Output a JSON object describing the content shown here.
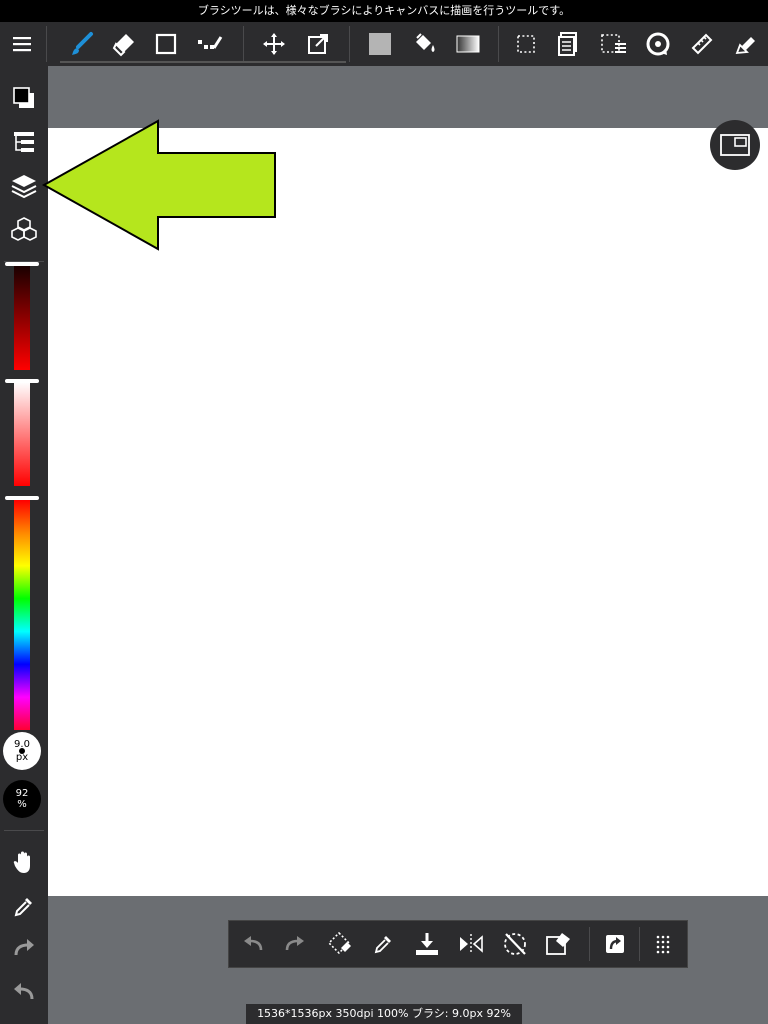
{
  "status_bar": {
    "message": "ブラシツールは、様々なブラシによりキャンバスに描画を行うツールです。"
  },
  "toolbar": {
    "icons": [
      "menu-icon",
      "brush-icon",
      "eraser-icon",
      "rectangle-icon",
      "dot-icon",
      "move-icon",
      "transform-icon",
      "fill-color-icon",
      "bucket-icon",
      "gradient-icon",
      "select-icon",
      "copy-layer-icon",
      "select-menu-icon",
      "rotate-icon",
      "ruler-icon",
      "pen-icon"
    ],
    "accent_color": "#1e90d8"
  },
  "sidebar": {
    "icons": [
      "color-swatch-icon",
      "layer-list-icon",
      "layers-icon",
      "materials-icon",
      "hand-icon",
      "eyedropper-icon",
      "redo-icon",
      "undo-icon"
    ],
    "brush_size": {
      "value": "9.0",
      "unit": "px"
    },
    "opacity": {
      "value": "92",
      "unit": "%"
    }
  },
  "canvas": {
    "background": "#ffffff"
  },
  "annotation": {
    "arrow_color": "#b5e61d",
    "target": "layers-icon"
  },
  "bottom_bar": {
    "icons": [
      "undo-icon",
      "redo-icon",
      "rotate-selection-icon",
      "eyedropper-icon",
      "save-icon",
      "flip-icon",
      "reset-rotation-icon",
      "clear-icon",
      "share-icon",
      "grid-menu-icon"
    ]
  },
  "info_bar": {
    "text": "1536*1536px 350dpi 100% ブラシ: 9.0px 92%"
  }
}
